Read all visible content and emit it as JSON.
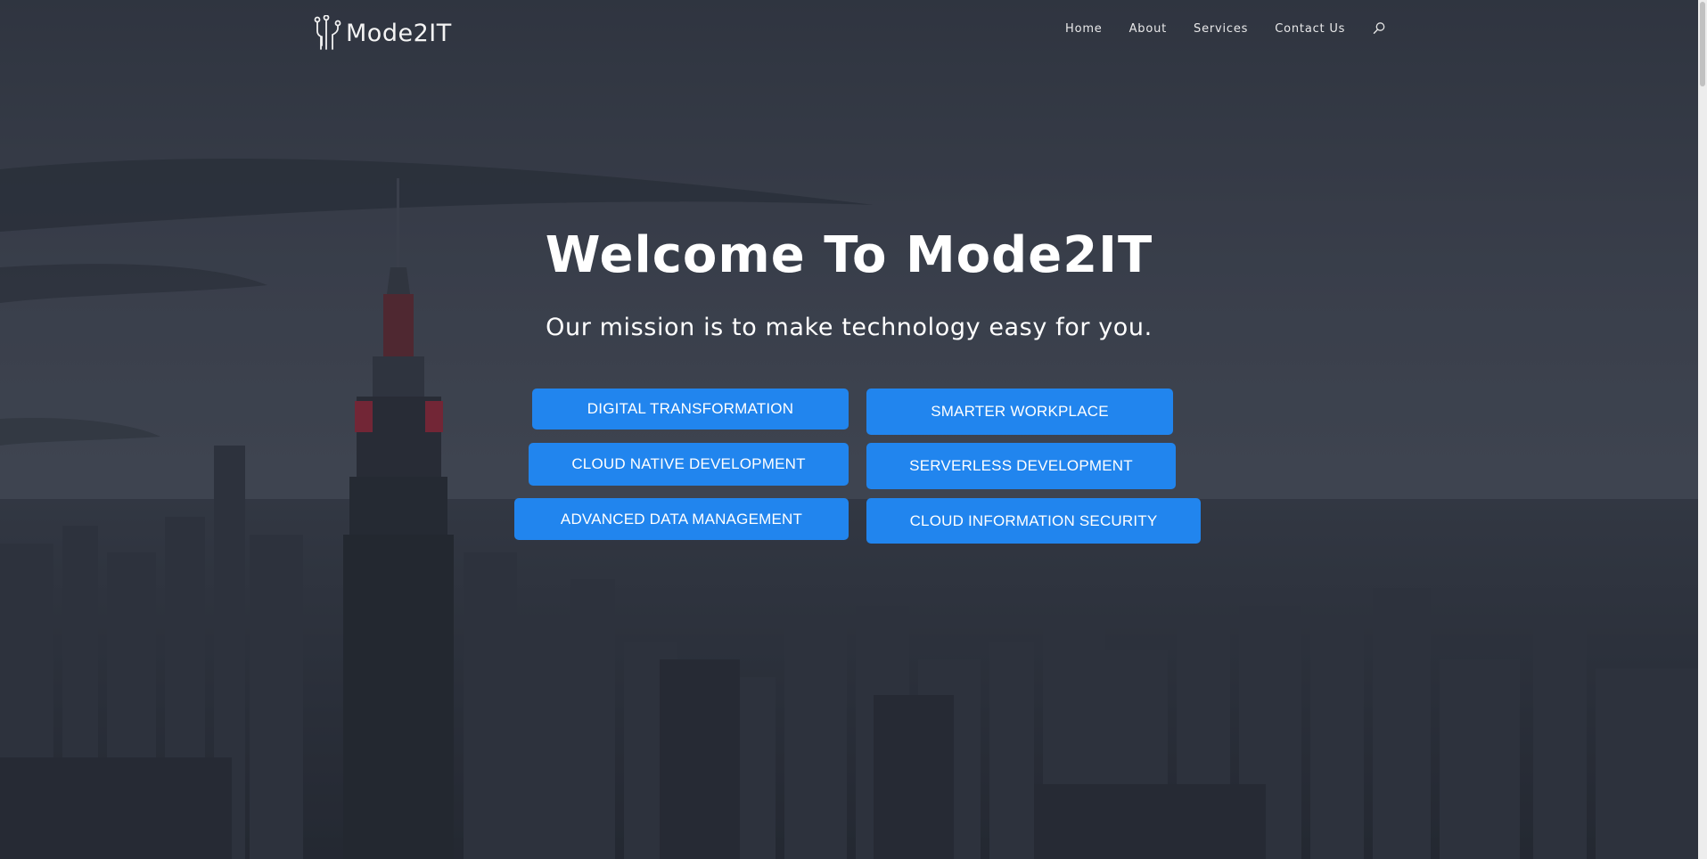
{
  "brand": {
    "name": "Mode2IT",
    "logo_icon": "circuit-icon"
  },
  "nav": {
    "items": [
      "Home",
      "About",
      "Services",
      "Contact Us"
    ],
    "search_icon": "search-icon"
  },
  "hero": {
    "title": "Welcome To Mode2IT",
    "subtitle": "Our mission is to make technology easy for you."
  },
  "services": {
    "left": [
      "DIGITAL TRANSFORMATION",
      "CLOUD NATIVE DEVELOPMENT",
      "ADVANCED DATA MANAGEMENT"
    ],
    "right": [
      "SMARTER WORKPLACE",
      "SERVERLESS DEVELOPMENT",
      "CLOUD INFORMATION SECURITY"
    ]
  },
  "colors": {
    "button_bg": "#2185ee",
    "overlay": "#1c212c",
    "text": "#ffffff"
  }
}
